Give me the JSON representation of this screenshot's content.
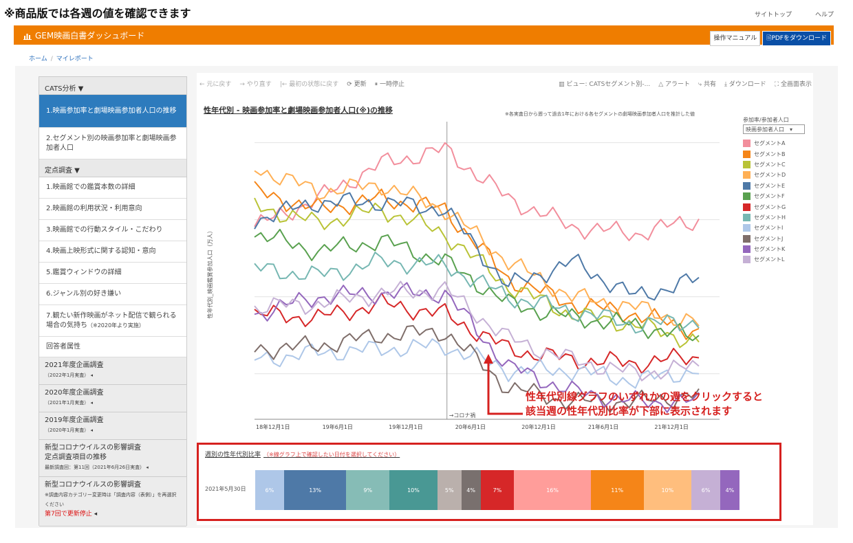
{
  "notice": "※商品版では各週の値を確認できます",
  "top_links": [
    "サイトトップ",
    "ヘルプ"
  ],
  "header": {
    "brand": "GEM映画白書ダッシュボード",
    "manual_btn": "操作マニュアル",
    "pdf_btn": "PDFをダウンロード",
    "bar_color": "#ef7d00"
  },
  "breadcrumb": [
    "ホーム",
    "マイレポート"
  ],
  "sidebar": {
    "cats_head": "CATS分析 ▼",
    "cats_items": [
      "1.映画参加率と劇場映画参加者人口の推移",
      "2.セグメント別の映画参加率と劇場映画参加者人口"
    ],
    "fixed_head": "定点調査 ▼",
    "fixed_items": [
      "1.映画館での鑑賞本数の詳細",
      "2.映画館の利用状況・利用意向",
      "3.映画館での行動スタイル・こだわり",
      "4.映画上映形式に関する認知・意向",
      "5.鑑賞ウィンドウの詳細",
      "6.ジャンル別の好き嫌い"
    ],
    "item7_main": "7.観たい新作映画がネット配信で観られる場合の気持ち",
    "item7_sub": "（※2020年より実施）",
    "respondent": "回答者属性",
    "groups": [
      {
        "title": "2021年度企画調査",
        "sub": "（2022年1月実査） ◂"
      },
      {
        "title": "2020年度企画調査",
        "sub": "（2021年1月実査） ◂"
      },
      {
        "title": "2019年度企画調査",
        "sub": "（2020年1月実査） ◂"
      }
    ],
    "corona1": {
      "title1": "新型コロナウイルスの影響調査",
      "title2": "定点調査項目の推移",
      "sub": "最新調査回：第11回（2021年6月26日実査） ◂"
    },
    "corona2": {
      "title": "新型コロナウイルスの影響調査",
      "sub1": "※調査内容カテゴリー変更時は「調査内容（表側）」を再選択ください",
      "stopped": "第7回で更新停止",
      "arrow": " ◂"
    }
  },
  "toolbar": {
    "left": [
      "← 元に戻す",
      "→ やり直す",
      "|← 最初の状態に戻す",
      "更新",
      "一時停止"
    ],
    "right": [
      "ビュー: CATSセグメント別-...",
      "アラート",
      "共有",
      "ダウンロード",
      "全画面表示"
    ]
  },
  "chart_title": "性年代別 - 映画参加率と劇場映画参加者人口(※)の推移",
  "chart_note": "※各実査日から遡って過去1年における各セグメントの劇場映画参加者人口を推計した値",
  "legend_title": "参加率/参加者人口",
  "legend_dropdown": "映画参加者人口　▾",
  "callout": [
    "性年代別線グラフのいずれかの週をクリックすると",
    "該当週の性年代別比率が下部に表示されます"
  ],
  "bottom": {
    "title": "週別の性年代別比率",
    "note": "（※線グラフ上で確認したい日付を選択してください）",
    "date": "2021年5月30日"
  },
  "chart_data": [
    {
      "type": "line",
      "x": [
        "18年12月1日",
        "19年6月1日",
        "19年12月1日",
        "20年6月1日",
        "20年12月1日",
        "21年6月1日",
        "21年12月1日"
      ],
      "ylabel": "性年代別_映画鑑賞参加人口（万人）",
      "annotation": "→コロナ禍",
      "grid": true,
      "legend_position": "right",
      "series": [
        {
          "name": "セグメントA",
          "color": "#f28e9c",
          "values": [
            50,
            58,
            68,
            72,
            58,
            50,
            48,
            52
          ]
        },
        {
          "name": "セグメントB",
          "color": "#f58518",
          "values": [
            60,
            55,
            58,
            55,
            35,
            28,
            25,
            20
          ]
        },
        {
          "name": "セグメントC",
          "color": "#b9c336",
          "values": [
            56,
            51,
            55,
            48,
            33,
            25,
            22,
            17
          ]
        },
        {
          "name": "セグメントD",
          "color": "#ffb055",
          "values": [
            67,
            60,
            62,
            55,
            40,
            30,
            27,
            22
          ]
        },
        {
          "name": "セグメントE",
          "color": "#4e79a7",
          "values": [
            52,
            57,
            57,
            55,
            33,
            40,
            30,
            35
          ]
        },
        {
          "name": "セグメントF",
          "color": "#59a14f",
          "values": [
            48,
            43,
            46,
            40,
            28,
            24,
            22,
            18
          ]
        },
        {
          "name": "セグメントG",
          "color": "#d62728",
          "values": [
            25,
            24,
            28,
            25,
            15,
            12,
            11,
            13
          ]
        },
        {
          "name": "セグメントH",
          "color": "#76b7b2",
          "values": [
            38,
            36,
            40,
            39,
            30,
            26,
            22,
            23
          ]
        },
        {
          "name": "セグメントI",
          "color": "#aec7e8",
          "values": [
            12,
            14,
            15,
            16,
            9,
            9,
            6,
            9
          ]
        },
        {
          "name": "セグメントJ",
          "color": "#7f6e6a",
          "values": [
            15,
            16,
            19,
            20,
            4,
            0,
            0,
            2
          ]
        },
        {
          "name": "セグメントK",
          "color": "#9467bd",
          "values": [
            25,
            30,
            31,
            31,
            10,
            3,
            0,
            0
          ]
        },
        {
          "name": "セグメントL",
          "color": "#c5b0d5",
          "values": [
            27,
            28,
            31,
            32,
            18,
            12,
            8,
            10
          ]
        }
      ]
    },
    {
      "type": "bar",
      "categories": [
        "2021年5月30日"
      ],
      "stacked": true,
      "segments": [
        {
          "label": "6%",
          "value": 6,
          "color": "#aec7e8"
        },
        {
          "label": "13%",
          "value": 13,
          "color": "#4e79a7"
        },
        {
          "label": "9%",
          "value": 9,
          "color": "#86bcb6"
        },
        {
          "label": "10%",
          "value": 10,
          "color": "#499894"
        },
        {
          "label": "5%",
          "value": 5,
          "color": "#bab0ac"
        },
        {
          "label": "4%",
          "value": 4,
          "color": "#79706e"
        },
        {
          "label": "7%",
          "value": 7,
          "color": "#d62728"
        },
        {
          "label": "16%",
          "value": 16,
          "color": "#ff9d9a"
        },
        {
          "label": "11%",
          "value": 11,
          "color": "#f58518"
        },
        {
          "label": "10%",
          "value": 10,
          "color": "#ffbe7d"
        },
        {
          "label": "6%",
          "value": 6,
          "color": "#c5b0d5"
        },
        {
          "label": "4%",
          "value": 4,
          "color": "#9467bd"
        }
      ]
    }
  ]
}
